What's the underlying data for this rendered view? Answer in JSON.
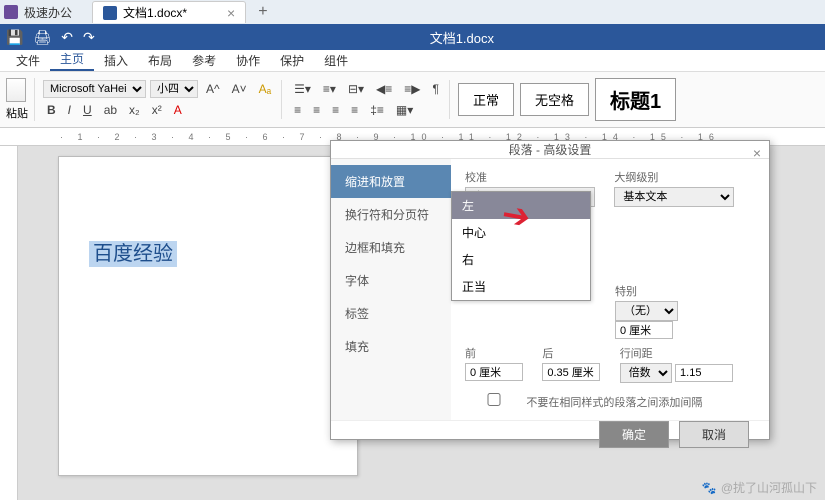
{
  "app": {
    "name": "极速办公",
    "tab_title": "文档1.docx*",
    "doc_title": "文档1.docx"
  },
  "quickbar": {
    "save": "💾",
    "print": "🖨",
    "undo": "↶",
    "redo": "↷"
  },
  "ribbon_tabs": [
    "文件",
    "主页",
    "插入",
    "布局",
    "参考",
    "协作",
    "保护",
    "组件"
  ],
  "ribbon": {
    "paste_label": "粘贴",
    "font_name": "Microsoft YaHei",
    "font_size": "小四",
    "styles": {
      "normal": "正常",
      "nospace": "无空格",
      "h1": "标题1"
    }
  },
  "document": {
    "selected_text": "百度经验"
  },
  "dialog": {
    "title": "段落 - 高级设置",
    "sidebar": [
      "缩进和放置",
      "换行符和分页符",
      "边框和填充",
      "字体",
      "标签",
      "填充"
    ],
    "fields": {
      "align_label": "校准",
      "align_value": "左",
      "align_options": [
        "左",
        "中心",
        "右",
        "正当"
      ],
      "outline_label": "大纲级别",
      "outline_value": "基本文本",
      "special_label": "特别",
      "special_value": "（无）",
      "special_num": "0 厘米",
      "before_label": "前",
      "before_value": "0 厘米",
      "after_label": "后",
      "after_value": "0.35 厘米",
      "spacing_label": "行间距",
      "spacing_value": "倍数",
      "spacing_num": "1.15",
      "checkbox_label": "不要在相同样式的段落之间添加间隔"
    },
    "ok": "确定",
    "cancel": "取消"
  },
  "watermark": "@扰了山河孤山下"
}
